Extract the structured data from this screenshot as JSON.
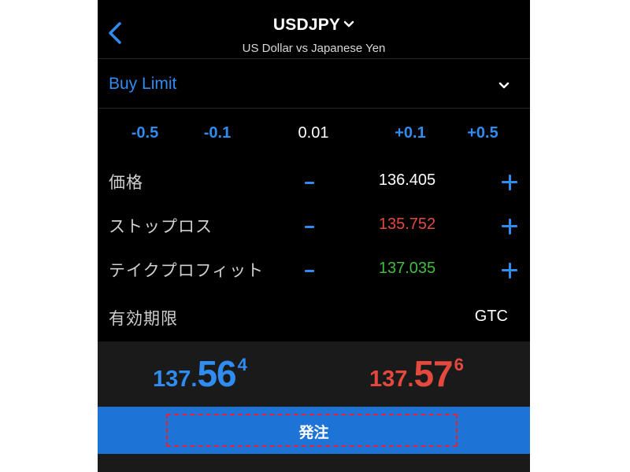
{
  "header": {
    "symbol": "USDJPY",
    "description": "US Dollar vs Japanese Yen",
    "back_icon": "chevron-left-icon",
    "symbol_dropdown_icon": "chevron-down-icon"
  },
  "order_type": {
    "label": "Buy Limit",
    "dropdown_icon": "chevron-down-icon"
  },
  "step": {
    "buttons": [
      "-0.5",
      "-0.1",
      "0.01",
      "+0.1",
      "+0.5"
    ],
    "current": "0.01"
  },
  "params": {
    "price": {
      "label": "価格",
      "value": "136.405",
      "color": "#ffffff"
    },
    "stop_loss": {
      "label": "ストップロス",
      "value": "135.752",
      "color": "#e5493e"
    },
    "take_profit": {
      "label": "テイクプロフィット",
      "value": "137.035",
      "color": "#3fbf3f"
    }
  },
  "expiry": {
    "label": "有効期限",
    "value": "GTC"
  },
  "quotes": {
    "bid": {
      "prefix": "137.",
      "big": "56",
      "sup": "4",
      "color": "#2f8cf0"
    },
    "ask": {
      "prefix": "137.",
      "big": "57",
      "sup": "6",
      "color": "#e5493e"
    }
  },
  "submit": {
    "label": "発注"
  },
  "colors": {
    "accent": "#2f8cf0",
    "submit_bg": "#1e74d6",
    "highlight_border": "#e0233c",
    "background": "#000000"
  }
}
